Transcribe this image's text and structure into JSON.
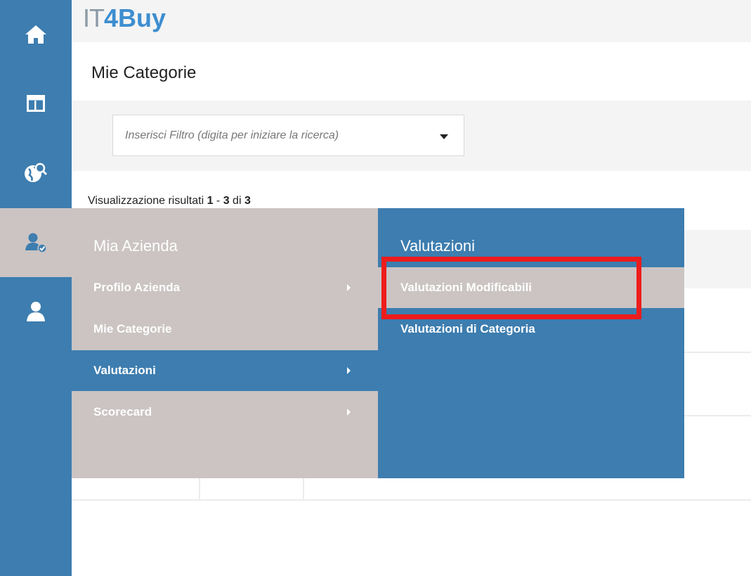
{
  "header": {
    "logo_prefix": "IT",
    "logo_suffix": "4Buy"
  },
  "page": {
    "title": "Mie Categorie"
  },
  "filter": {
    "placeholder": "Inserisci Filtro (digita per iniziare la ricerca)"
  },
  "results": {
    "prefix": "Visualizzazione risultati ",
    "from": "1",
    "sep": " - ",
    "to": "3",
    "of_label": " di ",
    "total": "3"
  },
  "rail": [
    {
      "icon": "home-icon"
    },
    {
      "icon": "dashboard-icon"
    },
    {
      "icon": "globe-search-icon"
    },
    {
      "icon": "user-check-icon",
      "active": true
    },
    {
      "icon": "user-icon"
    }
  ],
  "menu": {
    "left_heading": "Mia Azienda",
    "left_items": [
      {
        "label": "Profilo Azienda",
        "has_submenu": true
      },
      {
        "label": "Mie Categorie",
        "has_submenu": false
      },
      {
        "label": "Valutazioni",
        "has_submenu": true,
        "active": true
      },
      {
        "label": "Scorecard",
        "has_submenu": true
      }
    ],
    "right_heading": "Valutazioni",
    "right_items": [
      {
        "label": "Valutazioni Modificabili",
        "hovered": true
      },
      {
        "label": "Valutazioni di Categoria"
      }
    ]
  },
  "colors": {
    "primary": "#3d7daf",
    "menu_grey": "#cbc4c3",
    "highlight_red": "#ee1c1c",
    "logo_blue": "#3d8ed0"
  }
}
